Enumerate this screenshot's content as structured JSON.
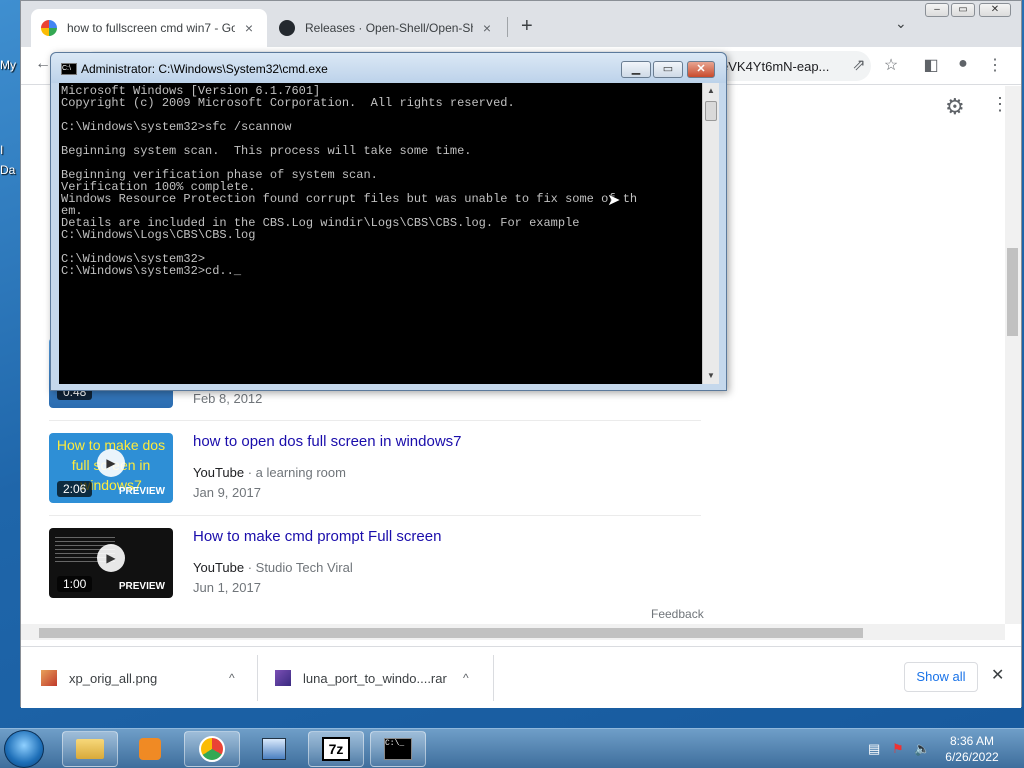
{
  "desktop": {
    "labels": [
      "My",
      "I",
      "Da"
    ]
  },
  "browser": {
    "tabs": [
      {
        "title": "how to fullscreen cmd win7 - Go",
        "close": "×",
        "active": true
      },
      {
        "title": "Releases · Open-Shell/Open-She",
        "close": "×",
        "active": false
      }
    ],
    "new_tab": "+",
    "tab_search": "⌄",
    "window_controls": {
      "minimize": "–",
      "maximize": "▭",
      "close": "✕"
    },
    "url_visible": "eVK4Yt6mN-eap...",
    "icons": [
      "back-icon",
      "share-icon",
      "bookmark-star-icon",
      "side-panel-icon",
      "profile-icon",
      "menu-icon",
      "settings-gear-icon"
    ]
  },
  "results": [
    {
      "title": "",
      "source": "",
      "channel": "",
      "date": "Feb 8, 2012",
      "duration": "0:48",
      "thumb_text": "",
      "preview": ""
    },
    {
      "title": "how to open dos full screen in windows7",
      "source": "YouTube",
      "channel": " · a learning room",
      "date": "Jan 9, 2017",
      "duration": "2:06",
      "thumb_text": "How  to make dos full screen in windows7",
      "preview": "PREVIEW"
    },
    {
      "title": "How to make cmd prompt Full screen",
      "source": "YouTube",
      "channel": " · Studio Tech Viral",
      "date": "Jun 1, 2017",
      "duration": "1:00",
      "thumb_text": "",
      "preview": "PREVIEW"
    }
  ],
  "feedback": "Feedback",
  "downloads": {
    "items": [
      {
        "name": "xp_orig_all.png",
        "chevron": "^"
      },
      {
        "name": "luna_port_to_windo....rar",
        "chevron": "^"
      }
    ],
    "show_all": "Show all",
    "close": "✕"
  },
  "cmd": {
    "title": "Administrator: C:\\Windows\\System32\\cmd.exe",
    "icon_text": "C:\\",
    "buttons": {
      "minimize": "▁",
      "maximize": "▭",
      "close": "✕"
    },
    "console_text": "Microsoft Windows [Version 6.1.7601]\nCopyright (c) 2009 Microsoft Corporation.  All rights reserved.\n\nC:\\Windows\\system32>sfc /scannow\n\nBeginning system scan.  This process will take some time.\n\nBeginning verification phase of system scan.\nVerification 100% complete.\nWindows Resource Protection found corrupt files but was unable to fix some of th\nem.\nDetails are included in the CBS.Log windir\\Logs\\CBS\\CBS.log. For example\nC:\\Windows\\Logs\\CBS\\CBS.log\n\nC:\\Windows\\system32>\nC:\\Windows\\system32>cd.._"
  },
  "taskbar": {
    "apps": [
      "explorer",
      "media-player",
      "chrome",
      "control-panel",
      "7-zip",
      "cmd"
    ],
    "app_labels": {
      "sevenzip": "7z",
      "cmd": "C:\\_"
    },
    "clock_time": "8:36 AM",
    "clock_date": "6/26/2022"
  }
}
